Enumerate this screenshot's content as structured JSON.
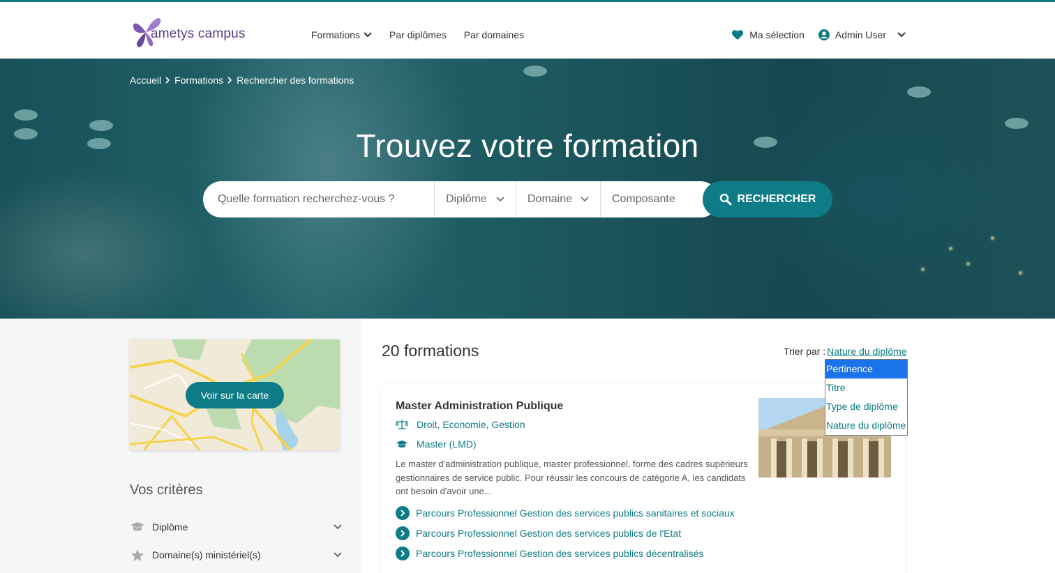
{
  "brand": {
    "logo_text": "ametys campus",
    "accent": "#0e7c86"
  },
  "nav": {
    "items": [
      {
        "label": "Formations",
        "has_dropdown": true
      },
      {
        "label": "Par diplômes",
        "has_dropdown": false
      },
      {
        "label": "Par domaines",
        "has_dropdown": false
      }
    ]
  },
  "user": {
    "selection_label": "Ma sélection",
    "name": "Admin User"
  },
  "breadcrumb": [
    "Accueil",
    "Formations",
    "Rechercher des formations"
  ],
  "hero": {
    "title": "Trouvez votre formation",
    "search_placeholder": "Quelle formation recherchez-vous ?",
    "filters": [
      "Diplôme",
      "Domaine",
      "Composante"
    ],
    "search_button": "RECHERCHER"
  },
  "sidebar": {
    "map_button": "Voir sur la carte",
    "criteria_title": "Vos critères",
    "criteria": [
      {
        "label": "Diplôme",
        "icon": "graduation-cap-icon"
      },
      {
        "label": "Domaine(s) ministériel(s)",
        "icon": "star-icon"
      }
    ]
  },
  "results": {
    "count_label": "20 formations",
    "sort": {
      "label": "Trier par :",
      "current": "Nature du diplôme",
      "options": [
        "Pertinence",
        "Titre",
        "Type de diplôme",
        "Nature du diplôme"
      ],
      "highlighted": "Pertinence"
    },
    "items": [
      {
        "title": "Master Administration Publique",
        "domain": "Droit, Economie, Gestion",
        "degree": "Master (LMD)",
        "description": "Le master d'administration publique, master professionnel, forme des cadres supérieurs gestionnaires de service public. Pour réussir les concours de catégorie A, les candidats ont besoin d'avoir une...",
        "paths": [
          "Parcours Professionnel Gestion des services publics sanitaires et sociaux",
          "Parcours Professionnel Gestion des services publics de l'Etat",
          "Parcours Professionnel Gestion des services publics décentralisés"
        ]
      }
    ]
  }
}
